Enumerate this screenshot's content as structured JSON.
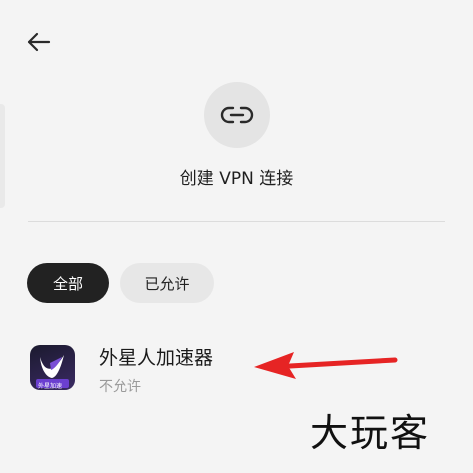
{
  "header": {
    "back_icon": "arrow-left-icon"
  },
  "create": {
    "icon": "link-icon",
    "label": "创建 VPN 连接"
  },
  "filters": [
    {
      "label": "全部",
      "selected": true
    },
    {
      "label": "已允许",
      "selected": false
    }
  ],
  "apps": [
    {
      "name": "外星人加速器",
      "status": "不允许",
      "icon": "app-icon-alien",
      "icon_caption": "外星加速"
    }
  ],
  "annotation": {
    "arrow_color": "#e62424"
  },
  "watermark": {
    "text": "大玩客"
  },
  "colors": {
    "background": "#f4f4f4",
    "chip_selected": "#222222",
    "chip_unselected": "#e7e7e7"
  }
}
